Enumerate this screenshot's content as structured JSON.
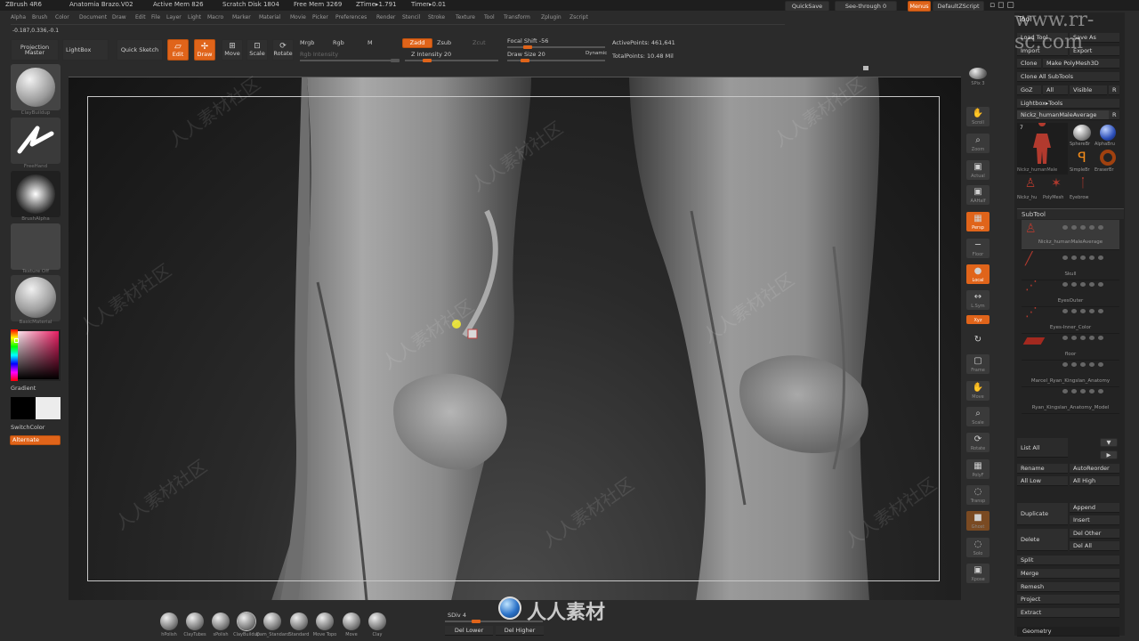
{
  "titlebar": {
    "app": "ZBrush 4R6",
    "document": "Anatomia Brazo.V02",
    "active_mem": "Active Mem 826",
    "scratch_disk": "Scratch Disk 1804",
    "free_mem": "Free Mem 3269",
    "ztime": "ZTime▸1.791",
    "timer": "Timer▸0.01",
    "quicksave": "QuickSave",
    "see_through": "See-through  0",
    "menus": "Menus",
    "default_script": "DefaultZScript"
  },
  "menubar": [
    "Alpha",
    "Brush",
    "Color",
    "Document",
    "Draw",
    "Edit",
    "File",
    "Layer",
    "Light",
    "Macro",
    "Marker",
    "Material",
    "Movie",
    "Picker",
    "Preferences",
    "Render",
    "Stencil",
    "Stroke",
    "Texture",
    "Tool",
    "Transform",
    "Zplugin",
    "Zscript"
  ],
  "shelf": {
    "projection_master": "Projection Master",
    "lightbox": "LightBox",
    "quick_sketch": "Quick Sketch",
    "edit": "Edit",
    "draw": "Draw",
    "move": "Move",
    "scale": "Scale",
    "rotate": "Rotate",
    "mrgb": "Mrgb",
    "rgb": "Rgb",
    "m": "M",
    "rgb_intensity": "Rgb Intensity",
    "zadd": "Zadd",
    "zsub": "Zsub",
    "zcut": "Zcut",
    "z_intensity": "Z Intensity 20",
    "focal_shift": "Focal Shift -56",
    "draw_size": "Draw Size 20",
    "dynamic": "Dynamic",
    "active_points": "ActivePoints: 461,641",
    "total_points": "TotalPoints: 10.48 Mil",
    "coords": "-0.187,0.336,-0.1"
  },
  "left": {
    "brush_caption": "ClayBuildup",
    "stroke_caption": "FreeHand",
    "alpha_caption": "BrushAlpha",
    "texture_caption": "Texture Off",
    "material_caption": "BasicMaterial",
    "gradient": "Gradient",
    "switch_color": "SwitchColor",
    "alternate": "Alternate"
  },
  "rightshelf": [
    {
      "icon": "SPix",
      "label": "SPix 3"
    },
    {
      "icon": "✋",
      "label": "Scroll"
    },
    {
      "icon": "🔍",
      "label": "Zoom"
    },
    {
      "icon": "▣",
      "label": "Actual"
    },
    {
      "icon": "▣",
      "label": "AAHalf"
    },
    {
      "icon": "▦",
      "label": "Persp"
    },
    {
      "icon": "─",
      "label": "Floor"
    },
    {
      "icon": "●",
      "label": "Local"
    },
    {
      "icon": "↔",
      "label": "L.Sym"
    },
    {
      "icon": "xyz",
      "label": "Xyz"
    },
    {
      "icon": "↻",
      "label": ""
    },
    {
      "icon": "▢",
      "label": "Frame"
    },
    {
      "icon": "✋",
      "label": "Move"
    },
    {
      "icon": "⌕",
      "label": "Scale"
    },
    {
      "icon": "⟳",
      "label": "Rotate"
    },
    {
      "icon": "▦",
      "label": "PolyF"
    },
    {
      "icon": "◌",
      "label": "Transp"
    },
    {
      "icon": "■",
      "label": "Ghost"
    },
    {
      "icon": "◌",
      "label": "Solo"
    },
    {
      "icon": "▣",
      "label": "Xpose"
    }
  ],
  "tool": {
    "title": "Tool",
    "load_tool": "Load Tool",
    "save_as": "Save As",
    "import": "Import",
    "export": "Export",
    "clone": "Clone",
    "make_polymesh": "Make PolyMesh3D",
    "clone_all": "Clone All SubTools",
    "goz": "GoZ",
    "all": "All",
    "visible": "Visible",
    "r": "R",
    "lightbox_tools": "Lightbox▸Tools",
    "current_tool": "Nickz_humanMaleAverage",
    "r2": "R",
    "thumb_count": "7",
    "thumb_labels": [
      "Nickz_humanMale",
      "SphereBr",
      "AlphaBru",
      "SimpleBr",
      "EraserBr",
      "Nickz_hu",
      "PolyMesh",
      "Eyebrow"
    ],
    "subtool_header": "SubTool",
    "subtools": [
      "Nickz_humanMaleAverage",
      "Skull",
      "EyesOuter",
      "Eyes-Inner_Color",
      "floor",
      "Marcel_Ryan_Kingslan_Anatomy",
      "Ryan_Kingslan_Anatomy_Model"
    ],
    "list_all": "List All",
    "rename": "Rename",
    "autoreorder": "AutoReorder",
    "all_low": "All Low",
    "all_high": "All High",
    "append": "Append",
    "duplicate": "Duplicate",
    "insert": "Insert",
    "delete": "Delete",
    "del_other": "Del Other",
    "del_all": "Del All",
    "split": "Split",
    "merge": "Merge",
    "remesh": "Remesh",
    "project": "Project",
    "extract": "Extract",
    "geometry": "Geometry"
  },
  "bottom": {
    "brushes": [
      "hPolish",
      "ClayTubes",
      "sPolish",
      "ClayBuildup",
      "Dam_Standard",
      "Standard",
      "Move Topo",
      "Move",
      "Clay"
    ],
    "sdiv": "SDiv 4",
    "del_lower": "Del Lower",
    "del_higher": "Del Higher"
  },
  "watermarks": {
    "site": "www.rr-sc.com",
    "cn": "人人素材社区",
    "logo": "人人素材"
  }
}
